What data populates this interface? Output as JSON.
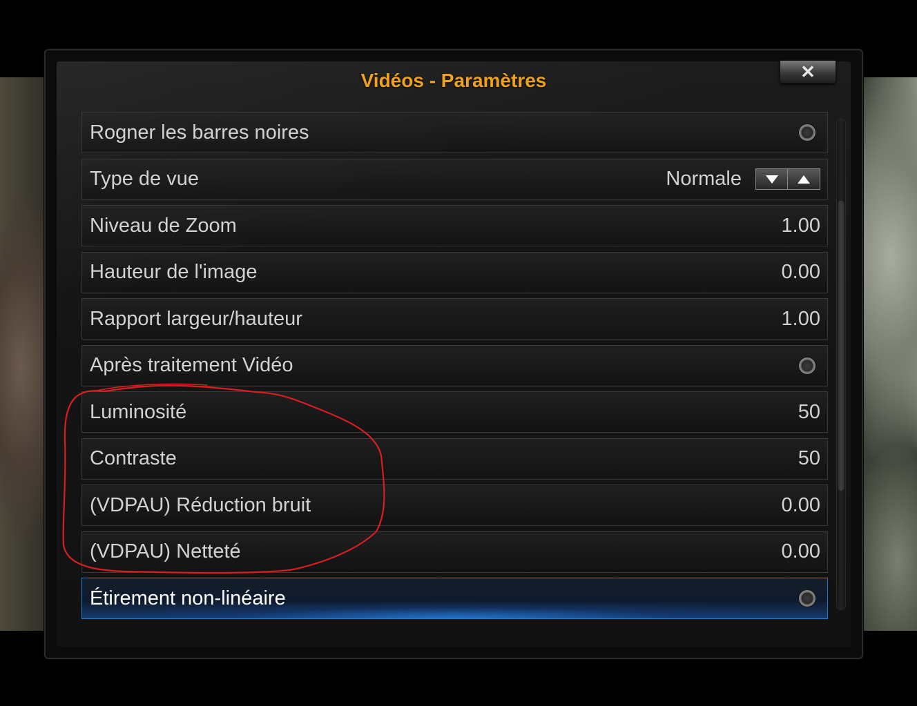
{
  "dialog": {
    "title": "Vidéos - Paramètres",
    "close_glyph": "✕"
  },
  "settings": [
    {
      "label": "Rogner les barres noires",
      "type": "toggle",
      "value": ""
    },
    {
      "label": "Type de vue",
      "type": "spinner",
      "value": "Normale"
    },
    {
      "label": "Niveau de Zoom",
      "type": "value",
      "value": "1.00"
    },
    {
      "label": "Hauteur de l'image",
      "type": "value",
      "value": "0.00"
    },
    {
      "label": "Rapport largeur/hauteur",
      "type": "value",
      "value": "1.00"
    },
    {
      "label": "Après traitement Vidéo",
      "type": "toggle",
      "value": ""
    },
    {
      "label": "Luminosité",
      "type": "value",
      "value": "50"
    },
    {
      "label": "Contraste",
      "type": "value",
      "value": "50"
    },
    {
      "label": "(VDPAU) Réduction bruit",
      "type": "value",
      "value": "0.00"
    },
    {
      "label": "(VDPAU) Netteté",
      "type": "value",
      "value": "0.00"
    },
    {
      "label": "Étirement non-linéaire",
      "type": "toggle",
      "value": "",
      "focused": true
    }
  ],
  "icons": {
    "close": "close-icon",
    "spinner_down": "arrow-down-icon",
    "spinner_up": "arrow-up-icon",
    "toggle": "radio-toggle-icon"
  },
  "colors": {
    "title": "#f0a21c",
    "focus_border": "#2b79c9",
    "annotation": "#d81e1e"
  }
}
